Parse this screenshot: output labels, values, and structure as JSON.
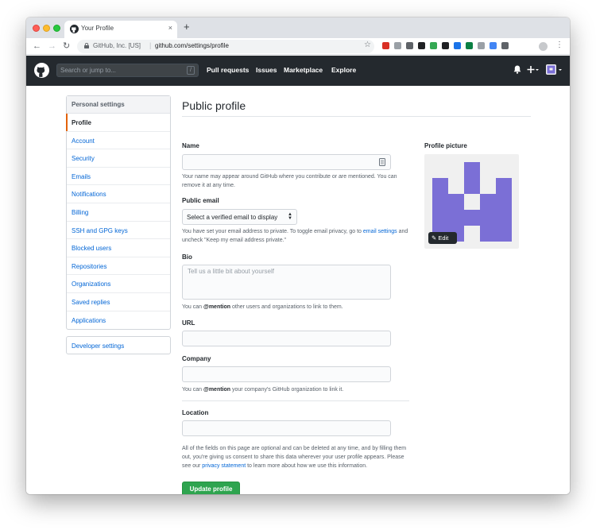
{
  "browser": {
    "tab_title": "Your Profile",
    "new_tab": "+",
    "close_tab": "×",
    "site_identity": "GitHub, Inc. [US]",
    "url": "github.com/settings/profile",
    "extension_colors": [
      "#d93025",
      "#9aa0a6",
      "#5f6368",
      "#202124",
      "#34a853",
      "#202124",
      "#1a73e8",
      "#0b8043",
      "#9aa0a6",
      "#4285f4",
      "#5f6368"
    ]
  },
  "header": {
    "search_placeholder": "Search or jump to...",
    "search_key": "/",
    "nav": [
      "Pull requests",
      "Issues",
      "Marketplace",
      "Explore"
    ]
  },
  "sidebar": {
    "heading": "Personal settings",
    "items": [
      {
        "label": "Profile"
      },
      {
        "label": "Account"
      },
      {
        "label": "Security"
      },
      {
        "label": "Emails"
      },
      {
        "label": "Notifications"
      },
      {
        "label": "Billing"
      },
      {
        "label": "SSH and GPG keys"
      },
      {
        "label": "Blocked users"
      },
      {
        "label": "Repositories"
      },
      {
        "label": "Organizations"
      },
      {
        "label": "Saved replies"
      },
      {
        "label": "Applications"
      }
    ],
    "developer_settings": "Developer settings"
  },
  "main": {
    "title": "Public profile",
    "name": {
      "label": "Name",
      "value": "",
      "note": "Your name may appear around GitHub where you contribute or are mentioned. You can remove it at any time."
    },
    "email": {
      "label": "Public email",
      "selected": "Select a verified email to display",
      "note_pre": "You have set your email address to private. To toggle email privacy, go to ",
      "note_link": "email settings",
      "note_post": " and uncheck \"Keep my email address private.\""
    },
    "bio": {
      "label": "Bio",
      "placeholder": "Tell us a little bit about yourself",
      "note_pre": "You can ",
      "note_mention": "@mention",
      "note_post": " other users and organizations to link to them."
    },
    "url": {
      "label": "URL",
      "value": ""
    },
    "company": {
      "label": "Company",
      "value": "",
      "note_pre": "You can ",
      "note_mention": "@mention",
      "note_post": " your company's GitHub organization to link it."
    },
    "location": {
      "label": "Location",
      "value": ""
    },
    "disclaimer_pre": "All of the fields on this page are optional and can be deleted at any time, and by filling them out, you're giving us consent to share this data wherever your user profile appears. Please see our ",
    "disclaimer_link": "privacy statement",
    "disclaimer_post": " to learn more about how we use this information.",
    "update_button": "Update profile"
  },
  "profile_picture": {
    "label": "Profile picture",
    "edit_label": "Edit",
    "avatar_color": "#7b6fd6"
  }
}
